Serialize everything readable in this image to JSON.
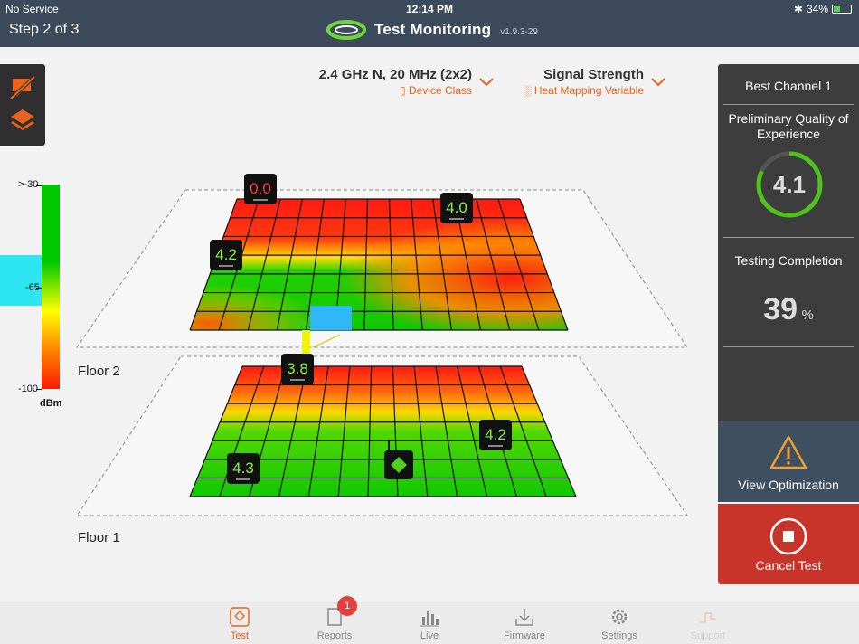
{
  "status": {
    "carrier": "No Service",
    "time": "12:14 PM",
    "battery": "34%"
  },
  "header": {
    "step": "Step 2 of 3",
    "title": "Test Monitoring",
    "version": "v1.9.3-29"
  },
  "selectors": {
    "device": {
      "value": "2.4 GHz N, 20 MHz (2x2)",
      "label": "Device Class"
    },
    "variable": {
      "value": "Signal Strength",
      "label": "Heat Mapping Variable"
    }
  },
  "legend": {
    "top": ">-30",
    "mid": "-65",
    "bottom": "-100",
    "unit": "dBm"
  },
  "floors": {
    "floor2": "Floor 2",
    "floor1": "Floor 1"
  },
  "markers": {
    "m1": "0.0",
    "m2": "4.0",
    "m3": "4.2",
    "m4": "3.8",
    "m5": "4.2",
    "m6": "4.3"
  },
  "panel": {
    "best_channel": "Best Channel 1",
    "qoe_label": "Preliminary Quality of Experience",
    "qoe_value": "4.1",
    "qoe_fraction": 0.82,
    "testing_label": "Testing Completion",
    "completion_value": "39",
    "completion_unit": "%",
    "view_optimization": "View Optimization",
    "cancel_test": "Cancel Test"
  },
  "tabs": [
    {
      "label": "Test",
      "icon": "test-icon",
      "active": true
    },
    {
      "label": "Reports",
      "icon": "reports-icon",
      "badge": "1"
    },
    {
      "label": "Live",
      "icon": "live-chart-icon"
    },
    {
      "label": "Firmware",
      "icon": "download-icon"
    },
    {
      "label": "Settings",
      "icon": "gear-icon"
    },
    {
      "label": "Support",
      "icon": "support-icon"
    }
  ],
  "colors": {
    "accent": "#e8641e",
    "header": "#3c4a5c",
    "cancel": "#c8332a",
    "ring": "#4fc21e"
  }
}
